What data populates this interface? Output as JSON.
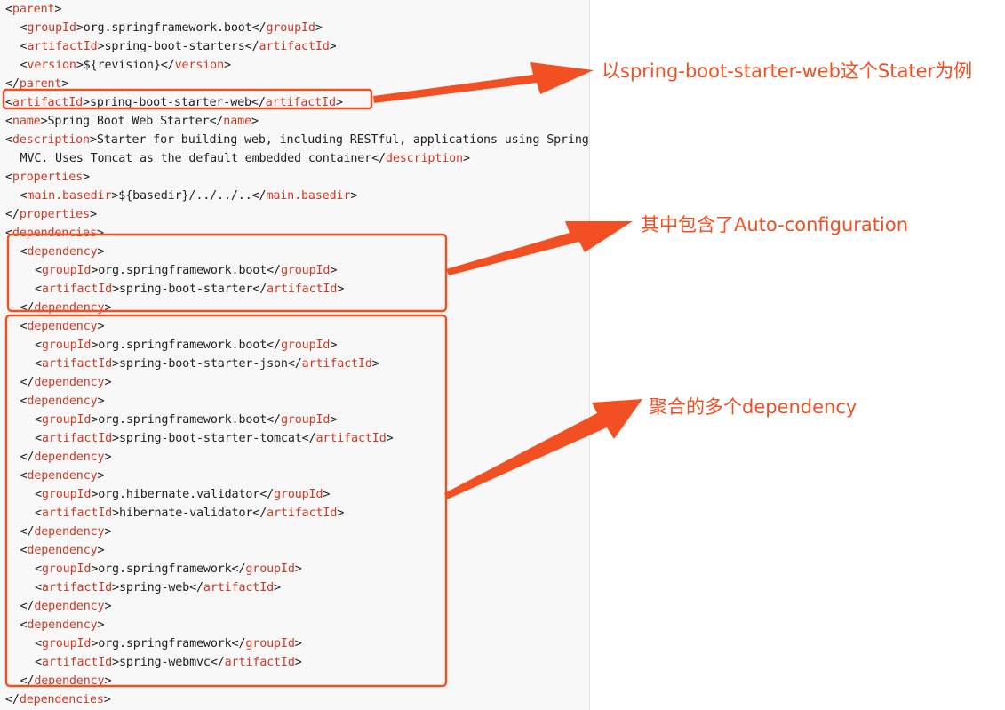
{
  "lines": [
    {
      "indent": 0,
      "segs": [
        [
          "p",
          "<"
        ],
        [
          "t",
          "parent"
        ],
        [
          "p",
          ">"
        ]
      ]
    },
    {
      "indent": 1,
      "segs": [
        [
          "p",
          "<"
        ],
        [
          "t",
          "groupId"
        ],
        [
          "p",
          ">org.springframework.boot</"
        ],
        [
          "t",
          "groupId"
        ],
        [
          "p",
          ">"
        ]
      ]
    },
    {
      "indent": 1,
      "segs": [
        [
          "p",
          "<"
        ],
        [
          "t",
          "artifactId"
        ],
        [
          "p",
          ">spring-boot-starters</"
        ],
        [
          "t",
          "artifactId"
        ],
        [
          "p",
          ">"
        ]
      ]
    },
    {
      "indent": 1,
      "segs": [
        [
          "p",
          "<"
        ],
        [
          "t",
          "version"
        ],
        [
          "p",
          ">${revision}</"
        ],
        [
          "t",
          "version"
        ],
        [
          "p",
          ">"
        ]
      ]
    },
    {
      "indent": 0,
      "segs": [
        [
          "p",
          "</"
        ],
        [
          "t",
          "parent"
        ],
        [
          "p",
          ">"
        ]
      ]
    },
    {
      "indent": 0,
      "segs": [
        [
          "p",
          "<"
        ],
        [
          "t",
          "artifactId"
        ],
        [
          "p",
          ">spring-boot-starter-web</"
        ],
        [
          "t",
          "artifactId"
        ],
        [
          "p",
          ">"
        ]
      ]
    },
    {
      "indent": 0,
      "segs": [
        [
          "p",
          "<"
        ],
        [
          "t",
          "name"
        ],
        [
          "p",
          ">Spring Boot Web Starter</"
        ],
        [
          "t",
          "name"
        ],
        [
          "p",
          ">"
        ]
      ]
    },
    {
      "indent": 0,
      "segs": [
        [
          "p",
          "<"
        ],
        [
          "t",
          "description"
        ],
        [
          "p",
          ">Starter for building web, including RESTful, applications using Spring"
        ]
      ]
    },
    {
      "indent": 1,
      "segs": [
        [
          "p",
          "MVC. Uses Tomcat as the default embedded container</"
        ],
        [
          "t",
          "description"
        ],
        [
          "p",
          ">"
        ]
      ]
    },
    {
      "indent": 0,
      "segs": [
        [
          "p",
          "<"
        ],
        [
          "t",
          "properties"
        ],
        [
          "p",
          ">"
        ]
      ]
    },
    {
      "indent": 1,
      "segs": [
        [
          "p",
          "<"
        ],
        [
          "t",
          "main.basedir"
        ],
        [
          "p",
          ">${basedir}/../../..</"
        ],
        [
          "t",
          "main.basedir"
        ],
        [
          "p",
          ">"
        ]
      ]
    },
    {
      "indent": 0,
      "segs": [
        [
          "p",
          "</"
        ],
        [
          "t",
          "properties"
        ],
        [
          "p",
          ">"
        ]
      ]
    },
    {
      "indent": 0,
      "segs": [
        [
          "p",
          "<"
        ],
        [
          "t",
          "dependencies"
        ],
        [
          "p",
          ">"
        ]
      ]
    },
    {
      "indent": 1,
      "segs": [
        [
          "p",
          "<"
        ],
        [
          "t",
          "dependency"
        ],
        [
          "p",
          ">"
        ]
      ]
    },
    {
      "indent": 2,
      "segs": [
        [
          "p",
          "<"
        ],
        [
          "t",
          "groupId"
        ],
        [
          "p",
          ">org.springframework.boot</"
        ],
        [
          "t",
          "groupId"
        ],
        [
          "p",
          ">"
        ]
      ]
    },
    {
      "indent": 2,
      "segs": [
        [
          "p",
          "<"
        ],
        [
          "t",
          "artifactId"
        ],
        [
          "p",
          ">spring-boot-starter</"
        ],
        [
          "t",
          "artifactId"
        ],
        [
          "p",
          ">"
        ]
      ]
    },
    {
      "indent": 1,
      "segs": [
        [
          "p",
          "</"
        ],
        [
          "t",
          "dependency"
        ],
        [
          "p",
          ">"
        ]
      ]
    },
    {
      "indent": 1,
      "segs": [
        [
          "p",
          "<"
        ],
        [
          "t",
          "dependency"
        ],
        [
          "p",
          ">"
        ]
      ]
    },
    {
      "indent": 2,
      "segs": [
        [
          "p",
          "<"
        ],
        [
          "t",
          "groupId"
        ],
        [
          "p",
          ">org.springframework.boot</"
        ],
        [
          "t",
          "groupId"
        ],
        [
          "p",
          ">"
        ]
      ]
    },
    {
      "indent": 2,
      "segs": [
        [
          "p",
          "<"
        ],
        [
          "t",
          "artifactId"
        ],
        [
          "p",
          ">spring-boot-starter-json</"
        ],
        [
          "t",
          "artifactId"
        ],
        [
          "p",
          ">"
        ]
      ]
    },
    {
      "indent": 1,
      "segs": [
        [
          "p",
          "</"
        ],
        [
          "t",
          "dependency"
        ],
        [
          "p",
          ">"
        ]
      ]
    },
    {
      "indent": 1,
      "segs": [
        [
          "p",
          "<"
        ],
        [
          "t",
          "dependency"
        ],
        [
          "p",
          ">"
        ]
      ]
    },
    {
      "indent": 2,
      "segs": [
        [
          "p",
          "<"
        ],
        [
          "t",
          "groupId"
        ],
        [
          "p",
          ">org.springframework.boot</"
        ],
        [
          "t",
          "groupId"
        ],
        [
          "p",
          ">"
        ]
      ]
    },
    {
      "indent": 2,
      "segs": [
        [
          "p",
          "<"
        ],
        [
          "t",
          "artifactId"
        ],
        [
          "p",
          ">spring-boot-starter-tomcat</"
        ],
        [
          "t",
          "artifactId"
        ],
        [
          "p",
          ">"
        ]
      ]
    },
    {
      "indent": 1,
      "segs": [
        [
          "p",
          "</"
        ],
        [
          "t",
          "dependency"
        ],
        [
          "p",
          ">"
        ]
      ]
    },
    {
      "indent": 1,
      "segs": [
        [
          "p",
          "<"
        ],
        [
          "t",
          "dependency"
        ],
        [
          "p",
          ">"
        ]
      ]
    },
    {
      "indent": 2,
      "segs": [
        [
          "p",
          "<"
        ],
        [
          "t",
          "groupId"
        ],
        [
          "p",
          ">org.hibernate.validator</"
        ],
        [
          "t",
          "groupId"
        ],
        [
          "p",
          ">"
        ]
      ]
    },
    {
      "indent": 2,
      "segs": [
        [
          "p",
          "<"
        ],
        [
          "t",
          "artifactId"
        ],
        [
          "p",
          ">hibernate-validator</"
        ],
        [
          "t",
          "artifactId"
        ],
        [
          "p",
          ">"
        ]
      ]
    },
    {
      "indent": 1,
      "segs": [
        [
          "p",
          "</"
        ],
        [
          "t",
          "dependency"
        ],
        [
          "p",
          ">"
        ]
      ]
    },
    {
      "indent": 1,
      "segs": [
        [
          "p",
          "<"
        ],
        [
          "t",
          "dependency"
        ],
        [
          "p",
          ">"
        ]
      ]
    },
    {
      "indent": 2,
      "segs": [
        [
          "p",
          "<"
        ],
        [
          "t",
          "groupId"
        ],
        [
          "p",
          ">org.springframework</"
        ],
        [
          "t",
          "groupId"
        ],
        [
          "p",
          ">"
        ]
      ]
    },
    {
      "indent": 2,
      "segs": [
        [
          "p",
          "<"
        ],
        [
          "t",
          "artifactId"
        ],
        [
          "p",
          ">spring-web</"
        ],
        [
          "t",
          "artifactId"
        ],
        [
          "p",
          ">"
        ]
      ]
    },
    {
      "indent": 1,
      "segs": [
        [
          "p",
          "</"
        ],
        [
          "t",
          "dependency"
        ],
        [
          "p",
          ">"
        ]
      ]
    },
    {
      "indent": 1,
      "segs": [
        [
          "p",
          "<"
        ],
        [
          "t",
          "dependency"
        ],
        [
          "p",
          ">"
        ]
      ]
    },
    {
      "indent": 2,
      "segs": [
        [
          "p",
          "<"
        ],
        [
          "t",
          "groupId"
        ],
        [
          "p",
          ">org.springframework</"
        ],
        [
          "t",
          "groupId"
        ],
        [
          "p",
          ">"
        ]
      ]
    },
    {
      "indent": 2,
      "segs": [
        [
          "p",
          "<"
        ],
        [
          "t",
          "artifactId"
        ],
        [
          "p",
          ">spring-webmvc</"
        ],
        [
          "t",
          "artifactId"
        ],
        [
          "p",
          ">"
        ]
      ]
    },
    {
      "indent": 1,
      "segs": [
        [
          "p",
          "</"
        ],
        [
          "t",
          "dependency"
        ],
        [
          "p",
          ">"
        ]
      ]
    },
    {
      "indent": 0,
      "segs": [
        [
          "p",
          "</"
        ],
        [
          "t",
          "dependencies"
        ],
        [
          "p",
          ">"
        ]
      ]
    }
  ],
  "annotations": {
    "starter_web": "以spring-boot-starter-web这个Stater为例",
    "auto_config": "其中包含了Auto-configuration",
    "aggregated": "聚合的多个dependency"
  },
  "colors": {
    "tag": "#cc3b26",
    "text": "#222222",
    "highlight": "#f25022",
    "editor_bg": "#f8f8f8"
  }
}
